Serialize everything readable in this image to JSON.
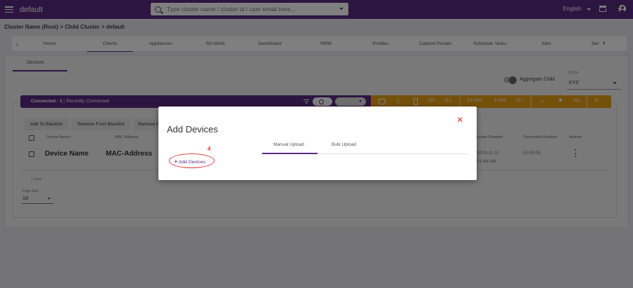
{
  "topbar": {
    "title": "default",
    "search_placeholder": "Type cluster name / cluster id / user email here...",
    "language": "English"
  },
  "breadcrumb": "Cluster Name (Root) > Child Cluster > default",
  "tabs": [
    "Home",
    "Clients",
    "Appliances",
    "SD-WAN",
    "Dashboard",
    "RRM",
    "Profiles",
    "Captive Portals",
    "Schedule Tasks",
    "Jobs",
    "Set"
  ],
  "active_tab": "Clients",
  "subtab": "Devices",
  "aggregate_child_label": "Aggregate Child",
  "ssid": {
    "label": "SSIDs",
    "value": "XYZ"
  },
  "status": {
    "connected": "Connected : 1",
    "recent": "Recently Connected",
    "iot": "IOT",
    "all1": "ALL",
    "ghz24": "2.4 GHz",
    "ghz5": "5 GHz",
    "all2": "ALL",
    "all3": "ALL"
  },
  "buttons": {
    "blacklist": "Add To Blacklist",
    "remove_blacklist": "Remove From Blacklist",
    "remove": "Remove F"
  },
  "table": {
    "headers": {
      "device_name": "Device Name ↑",
      "mac": "MAC Address",
      "lease": "Lease Duration",
      "connected": "Connected Duration",
      "actions": "Actions"
    },
    "row": {
      "device_name": "Device Name",
      "mac": "MAC-Address",
      "lease_date": "2023-11-11",
      "lease_time": "01:46 AM",
      "connected": "01:00:00"
    }
  },
  "total": "1 total",
  "page_size": {
    "label": "Page Size",
    "value": "10"
  },
  "modal": {
    "title": "Add Devices",
    "close": "✕",
    "tab_manual": "Manual Upload",
    "tab_bulk": "Bulk Upload",
    "annotation_number": "4",
    "add_devices_label": "Add Devices"
  }
}
